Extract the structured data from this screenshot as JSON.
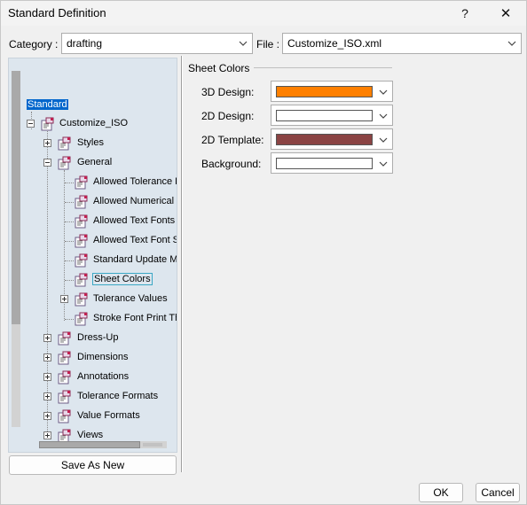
{
  "window": {
    "title": "Standard Definition",
    "help_label": "?",
    "close_label": "✕"
  },
  "category": {
    "label": "Category :",
    "value": "drafting"
  },
  "file": {
    "label": "File :",
    "value": "Customize_ISO.xml"
  },
  "tree": {
    "root": "Standard",
    "customize": "Customize_ISO",
    "items": [
      "Styles",
      "General",
      "Allowed Tolerance F",
      "Allowed Numerical F",
      "Allowed Text Fonts",
      "Allowed Text Font Si",
      "Standard Update M",
      "Sheet Colors",
      "Tolerance Values",
      "Stroke Font Print Thi",
      "Dress-Up",
      "Dimensions",
      "Annotations",
      "Tolerance Formats",
      "Value Formats",
      "Views"
    ]
  },
  "save_as_new_label": "Save As New",
  "sheet_colors": {
    "group_title": "Sheet Colors",
    "rows": [
      {
        "label": "3D Design:",
        "color": "#ff8000"
      },
      {
        "label": "2D Design:",
        "color": "#ffffff"
      },
      {
        "label": "2D Template:",
        "color": "#8b4444"
      },
      {
        "label": "Background:",
        "color": "#ffffff"
      }
    ]
  },
  "footer": {
    "ok_label": "OK",
    "cancel_label": "Cancel"
  }
}
